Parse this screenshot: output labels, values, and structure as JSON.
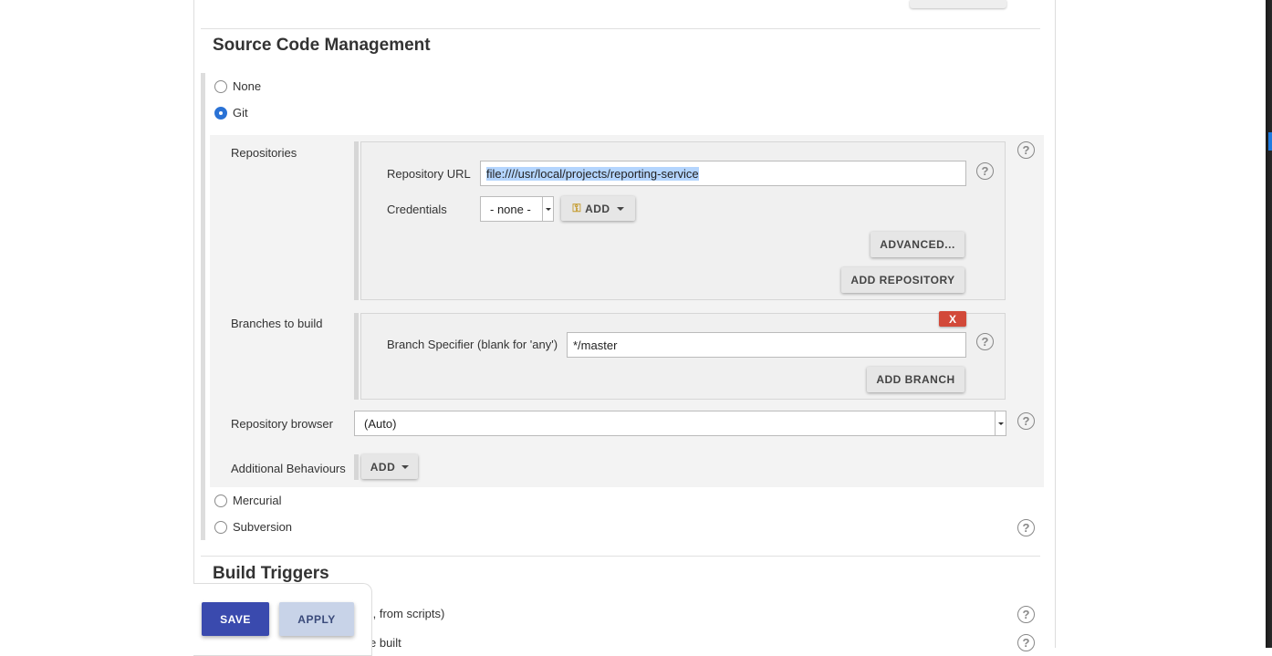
{
  "scm": {
    "title": "Source Code Management",
    "options": {
      "none": "None",
      "git": "Git",
      "mercurial": "Mercurial",
      "subversion": "Subversion"
    },
    "selected": "Git",
    "repositories_label": "Repositories",
    "repository_url_label": "Repository URL",
    "repository_url_value": "file:////usr/local/projects/reporting-service",
    "credentials_label": "Credentials",
    "credentials_value": "- none -",
    "add_label": "ADD",
    "advanced_label": "ADVANCED...",
    "add_repository_label": "ADD REPOSITORY",
    "branches_label": "Branches to build",
    "delete_branch_label": "X",
    "branch_specifier_label": "Branch Specifier (blank for 'any')",
    "branch_specifier_value": "*/master",
    "add_branch_label": "ADD BRANCH",
    "repository_browser_label": "Repository browser",
    "repository_browser_value": "(Auto)",
    "additional_behaviours_label": "Additional Behaviours",
    "help_glyph": "?"
  },
  "build_triggers": {
    "title": "Build Triggers",
    "partial_row_1": "., from scripts)",
    "partial_row_2": "e built"
  },
  "footer": {
    "save_label": "SAVE",
    "apply_label": "APPLY"
  },
  "colors": {
    "save": "#3a4aae",
    "apply": "#c8d3e8",
    "radio_checked": "#2a72d5",
    "delete": "#d24939"
  }
}
